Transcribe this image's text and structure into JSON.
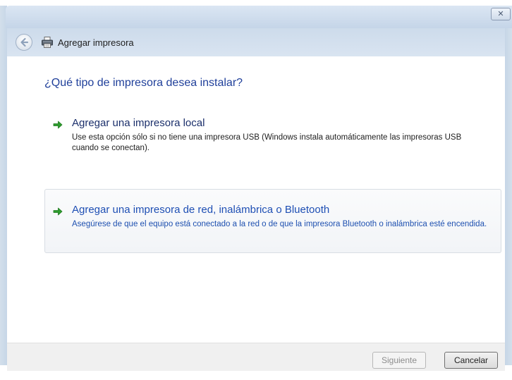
{
  "window": {
    "title": "Agregar impresora",
    "close_glyph": "✕"
  },
  "icons": {
    "back": "back-arrow-icon",
    "printer": "printer-icon",
    "option_arrow": "green-arrow-icon"
  },
  "colors": {
    "heading": "#1f3f9a",
    "link": "#1e4fb4",
    "arrow_green": "#2e9c2e"
  },
  "main": {
    "question": "¿Qué tipo de impresora desea instalar?",
    "options": [
      {
        "title": "Agregar una impresora local",
        "description": "Use esta opción sólo si no tiene una impresora USB (Windows instala automáticamente las impresoras USB cuando se conectan)."
      },
      {
        "title": "Agregar una impresora de red, inalámbrica o Bluetooth",
        "description": "Asegúrese de que el equipo está conectado a la red o de que la impresora Bluetooth o inalámbrica esté encendida."
      }
    ]
  },
  "footer": {
    "next_label": "Siguiente",
    "cancel_label": "Cancelar"
  }
}
